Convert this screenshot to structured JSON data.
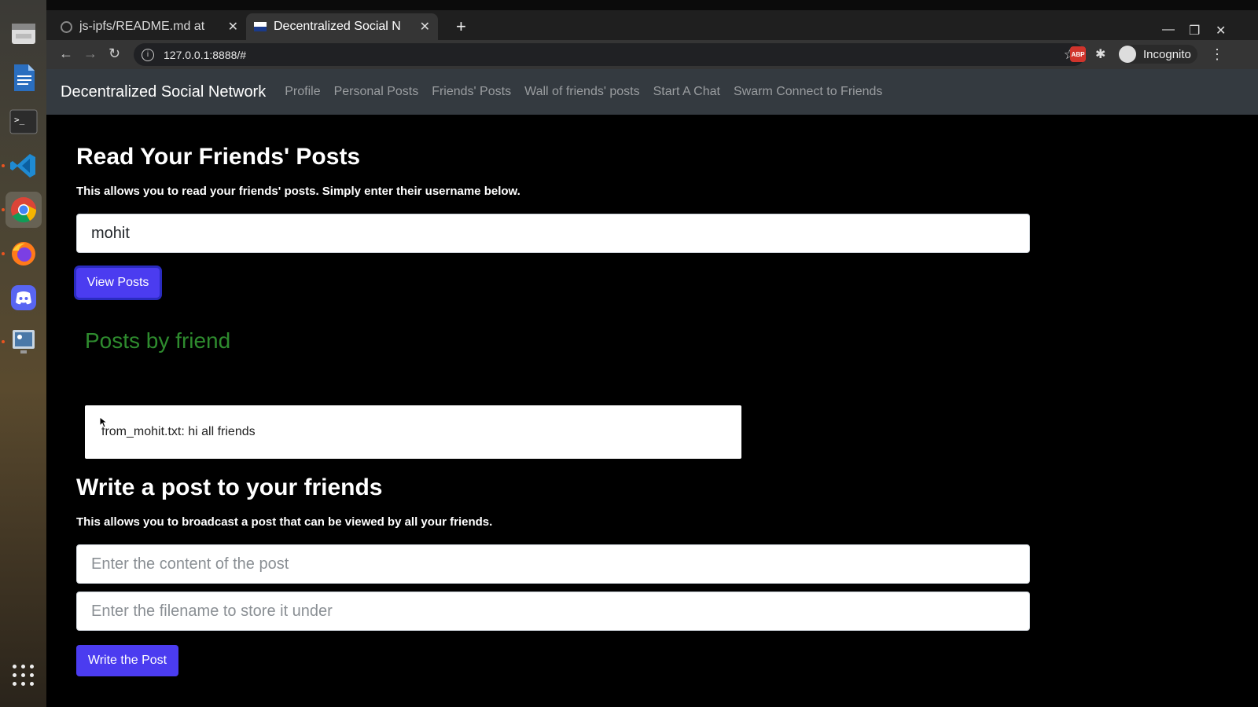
{
  "browser": {
    "tabs": [
      {
        "title": "js-ipfs/README.md at",
        "icon": "github-icon"
      },
      {
        "title": "Decentralized Social N",
        "icon": "site-favicon"
      }
    ],
    "url": "127.0.0.1:8888/#",
    "profile_label": "Incognito"
  },
  "site": {
    "brand": "Decentralized Social Network",
    "nav": [
      "Profile",
      "Personal Posts",
      "Friends' Posts",
      "Wall of friends' posts",
      "Start A Chat",
      "Swarm Connect to Friends"
    ]
  },
  "read_section": {
    "heading": "Read Your Friends' Posts",
    "description": "This allows you to read your friends' posts. Simply enter their username below.",
    "username_value": "mohit",
    "button_label": "View Posts",
    "posts_heading": "Posts by friend",
    "posts": [
      "from_mohit.txt: hi all friends"
    ]
  },
  "write_section": {
    "heading": "Write a post to your friends",
    "description": "This allows you to broadcast a post that can be viewed by all your friends.",
    "content_placeholder": "Enter the content of the post",
    "filename_placeholder": "Enter the filename to store it under",
    "button_label": "Write the Post"
  },
  "colors": {
    "primary_button": "#4b3cf0",
    "posts_heading": "#2e8b2e",
    "navbar": "#343a40"
  }
}
